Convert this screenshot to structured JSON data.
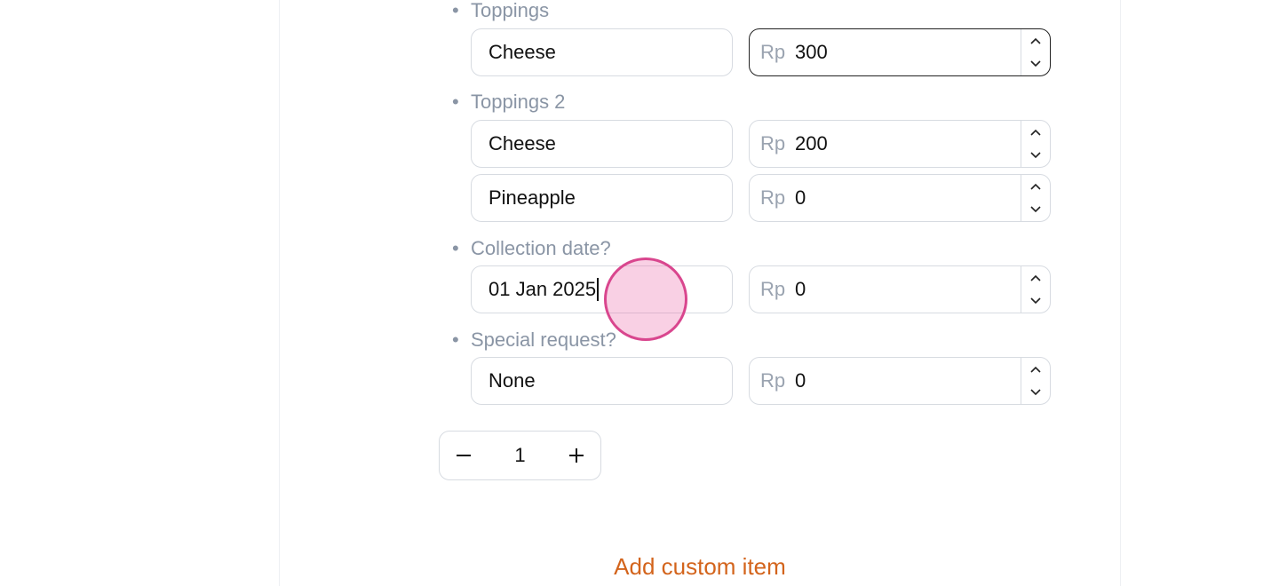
{
  "groups": [
    {
      "label": "Toppings",
      "options": [
        {
          "name": "Cheese",
          "currency": "Rp",
          "price": "300"
        }
      ]
    },
    {
      "label": "Toppings 2",
      "options": [
        {
          "name": "Cheese",
          "currency": "Rp",
          "price": "200"
        },
        {
          "name": "Pineapple",
          "currency": "Rp",
          "price": "0"
        }
      ]
    },
    {
      "label": "Collection date?",
      "options": [
        {
          "name": "01 Jan 2025",
          "currency": "Rp",
          "price": "0"
        }
      ]
    },
    {
      "label": "Special request?",
      "options": [
        {
          "name": "None",
          "currency": "Rp",
          "price": "0"
        }
      ]
    }
  ],
  "bullet": "•",
  "quantity": {
    "value": "1",
    "decrement": "−",
    "increment": "+"
  },
  "add_custom_item": "Add custom item",
  "icons": {
    "stepper_up": "chevron-up-icon",
    "stepper_down": "chevron-down-icon",
    "minus": "minus-icon",
    "plus": "plus-icon"
  },
  "colors": {
    "accent": "#d3641c",
    "label": "#8a95a5",
    "border": "#d7dbe1",
    "focus_border": "#222222"
  }
}
